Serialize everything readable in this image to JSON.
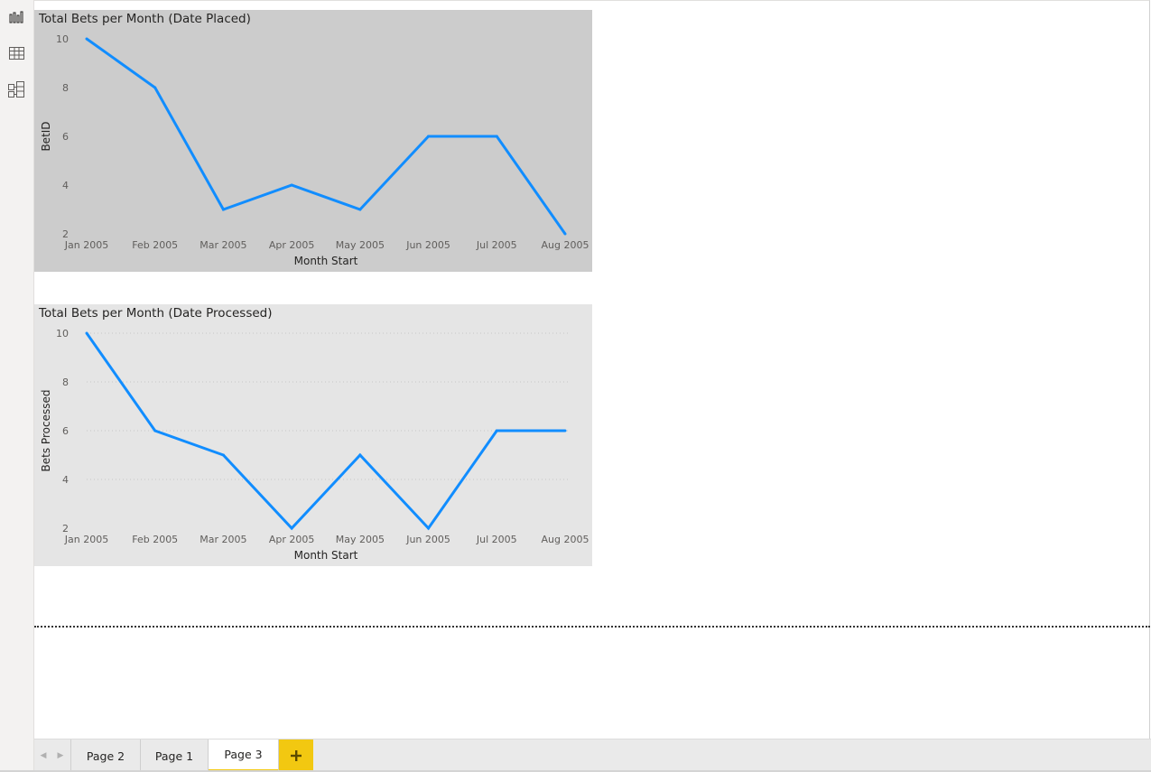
{
  "left_rail": {
    "icons": [
      "report-view-icon",
      "data-view-icon",
      "model-view-icon"
    ]
  },
  "charts": [
    {
      "title": "Total Bets per Month (Date Placed)",
      "background": "#cccccc",
      "gridlines": false
    },
    {
      "title": "Total Bets per Month (Date Processed)",
      "background": "#e5e5e5",
      "gridlines": true
    }
  ],
  "chart_data": [
    {
      "type": "line",
      "title": "Total Bets per Month (Date Placed)",
      "xlabel": "Month Start",
      "ylabel": "BetID",
      "categories": [
        "Jan 2005",
        "Feb 2005",
        "Mar 2005",
        "Apr 2005",
        "May 2005",
        "Jun 2005",
        "Jul 2005",
        "Aug 2005"
      ],
      "series": [
        {
          "values": [
            10,
            8,
            3,
            4,
            3,
            6,
            6,
            2
          ],
          "color": "#118dff"
        }
      ],
      "ylim": [
        2,
        10
      ],
      "yticks": [
        "10",
        "8",
        "6",
        "4",
        "2"
      ],
      "grid": false
    },
    {
      "type": "line",
      "title": "Total Bets per Month (Date Processed)",
      "xlabel": "Month Start",
      "ylabel": "Bets Processed",
      "categories": [
        "Jan 2005",
        "Feb 2005",
        "Mar 2005",
        "Apr 2005",
        "May 2005",
        "Jun 2005",
        "Jul 2005",
        "Aug 2005"
      ],
      "series": [
        {
          "values": [
            10,
            6,
            5,
            2,
            5,
            2,
            6,
            6
          ],
          "color": "#118dff"
        }
      ],
      "ylim": [
        2,
        10
      ],
      "yticks": [
        "10",
        "8",
        "6",
        "4",
        "2"
      ],
      "grid": true
    }
  ],
  "tabs": {
    "items": [
      {
        "label": "Page 2",
        "active": false
      },
      {
        "label": "Page 1",
        "active": false
      },
      {
        "label": "Page 3",
        "active": true
      }
    ],
    "add_icon": "plus-icon",
    "accent": "#f2c811"
  }
}
